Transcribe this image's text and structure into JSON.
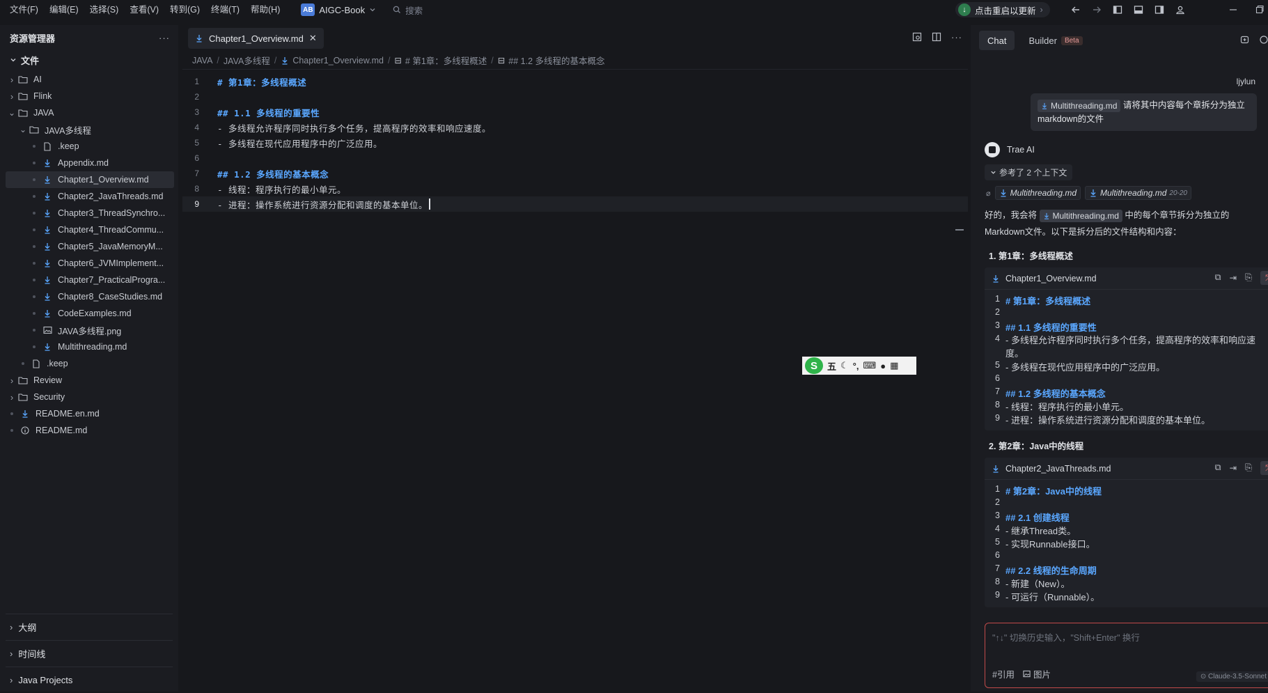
{
  "menu": [
    "文件(F)",
    "编辑(E)",
    "选择(S)",
    "查看(V)",
    "转到(G)",
    "终端(T)",
    "帮助(H)"
  ],
  "project": {
    "badge": "AB",
    "name": "AIGC-Book"
  },
  "search_placeholder": "搜索",
  "update_label": "点击重启以更新",
  "explorer": {
    "title": "资源管理器",
    "section": "文件",
    "items": [
      {
        "label": "AI",
        "type": "folder",
        "depth": 0,
        "state": "collapsed"
      },
      {
        "label": "Flink",
        "type": "folder",
        "depth": 0,
        "state": "collapsed"
      },
      {
        "label": "JAVA",
        "type": "folder",
        "depth": 0,
        "state": "expanded"
      },
      {
        "label": "JAVA多线程",
        "type": "folder",
        "depth": 1,
        "state": "expanded"
      },
      {
        "label": ".keep",
        "type": "file",
        "depth": 2
      },
      {
        "label": "Appendix.md",
        "type": "md",
        "depth": 2
      },
      {
        "label": "Chapter1_Overview.md",
        "type": "md",
        "depth": 2,
        "selected": true
      },
      {
        "label": "Chapter2_JavaThreads.md",
        "type": "md",
        "depth": 2
      },
      {
        "label": "Chapter3_ThreadSynchro...",
        "type": "md",
        "depth": 2
      },
      {
        "label": "Chapter4_ThreadCommu...",
        "type": "md",
        "depth": 2
      },
      {
        "label": "Chapter5_JavaMemoryM...",
        "type": "md",
        "depth": 2
      },
      {
        "label": "Chapter6_JVMImplement...",
        "type": "md",
        "depth": 2
      },
      {
        "label": "Chapter7_PracticalProgra...",
        "type": "md",
        "depth": 2
      },
      {
        "label": "Chapter8_CaseStudies.md",
        "type": "md",
        "depth": 2
      },
      {
        "label": "CodeExamples.md",
        "type": "md",
        "depth": 2
      },
      {
        "label": "JAVA多线程.png",
        "type": "image",
        "depth": 2
      },
      {
        "label": "Multithreading.md",
        "type": "md",
        "depth": 2
      },
      {
        "label": ".keep",
        "type": "file",
        "depth": 1
      },
      {
        "label": "Review",
        "type": "folder",
        "depth": 0,
        "state": "collapsed"
      },
      {
        "label": "Security",
        "type": "folder",
        "depth": 0,
        "state": "collapsed"
      },
      {
        "label": "README.en.md",
        "type": "md",
        "depth": 0
      },
      {
        "label": "README.md",
        "type": "info",
        "depth": 0
      }
    ],
    "bottom_sections": [
      "大纲",
      "时间线",
      "Java Projects"
    ]
  },
  "editor": {
    "tab_label": "Chapter1_Overview.md",
    "breadcrumbs": [
      "JAVA",
      "JAVA多线程",
      "Chapter1_Overview.md",
      "# 第1章：多线程概述",
      "## 1.2 多线程的基本概念"
    ],
    "lines": [
      {
        "n": "1",
        "text": "# 第1章：多线程概述",
        "heading": true
      },
      {
        "n": "2",
        "text": ""
      },
      {
        "n": "3",
        "text": "## 1.1 多线程的重要性",
        "heading": true
      },
      {
        "n": "4",
        "text": "- 多线程允许程序同时执行多个任务，提高程序的效率和响应速度。"
      },
      {
        "n": "5",
        "text": "- 多线程在现代应用程序中的广泛应用。"
      },
      {
        "n": "6",
        "text": ""
      },
      {
        "n": "7",
        "text": "## 1.2 多线程的基本概念",
        "heading": true
      },
      {
        "n": "8",
        "text": "- 线程：程序执行的最小单元。"
      },
      {
        "n": "9",
        "text": "- 进程：操作系统进行资源分配和调度的基本单位。",
        "current": true
      }
    ]
  },
  "ime": {
    "logo": "S",
    "mode": "五"
  },
  "chat": {
    "tabs": [
      "Chat",
      "Builder"
    ],
    "beta": "Beta",
    "user_name": "ljylun",
    "user_message": {
      "chip": "Multithreading.md",
      "text": "请将其中内容每个章拆分为独立markdown的文件"
    },
    "ai_name": "Trae AI",
    "context_label": "参考了 2 个上下文",
    "context_files": [
      {
        "name": "Multithreading.md",
        "lines": ""
      },
      {
        "name": "Multithreading.md",
        "lines": "20-20"
      }
    ],
    "reply_pre": "好的，我会将",
    "reply_chip": "Multithreading.md",
    "reply_post": "中的每个章节拆分为独立的Markdown文件。以下是拆分后的文件结构和内容：",
    "sections": [
      {
        "title": "1. 第1章：多线程概述",
        "file": "Chapter1_Overview.md",
        "lines": [
          {
            "n": "1",
            "text": "# 第1章：多线程概述",
            "heading": true
          },
          {
            "n": "2",
            "text": ""
          },
          {
            "n": "3",
            "text": "## 1.1 多线程的重要性",
            "heading": true
          },
          {
            "n": "4",
            "text": "- 多线程允许程序同时执行多个任务，提高程序的效率和响应速度。",
            "wrap": true
          },
          {
            "n": "5",
            "text": "- 多线程在现代应用程序中的广泛应用。"
          },
          {
            "n": "6",
            "text": ""
          },
          {
            "n": "7",
            "text": "## 1.2 多线程的基本概念",
            "heading": true
          },
          {
            "n": "8",
            "text": "- 线程：程序执行的最小单元。"
          },
          {
            "n": "9",
            "text": "- 进程：操作系统进行资源分配和调度的基本单位。"
          }
        ]
      },
      {
        "title": "2. 第2章：Java中的线程",
        "file": "Chapter2_JavaThreads.md",
        "lines": [
          {
            "n": "1",
            "text": "# 第2章：Java中的线程",
            "heading": true
          },
          {
            "n": "2",
            "text": ""
          },
          {
            "n": "3",
            "text": "## 2.1 创建线程",
            "heading": true
          },
          {
            "n": "4",
            "text": "- 继承Thread类。"
          },
          {
            "n": "5",
            "text": "- 实现Runnable接口。"
          },
          {
            "n": "6",
            "text": ""
          },
          {
            "n": "7",
            "text": "## 2.2 线程的生命周期",
            "heading": true
          },
          {
            "n": "8",
            "text": "- 新建（New）。"
          },
          {
            "n": "9",
            "text": "- 可运行（Runnable）。"
          }
        ]
      }
    ],
    "input_placeholder": "\"↑↓\" 切换历史输入，\"Shift+Enter\" 换行",
    "input_actions": [
      "#引用",
      "图片"
    ],
    "model": "Claude-3.5-Sonnet"
  }
}
